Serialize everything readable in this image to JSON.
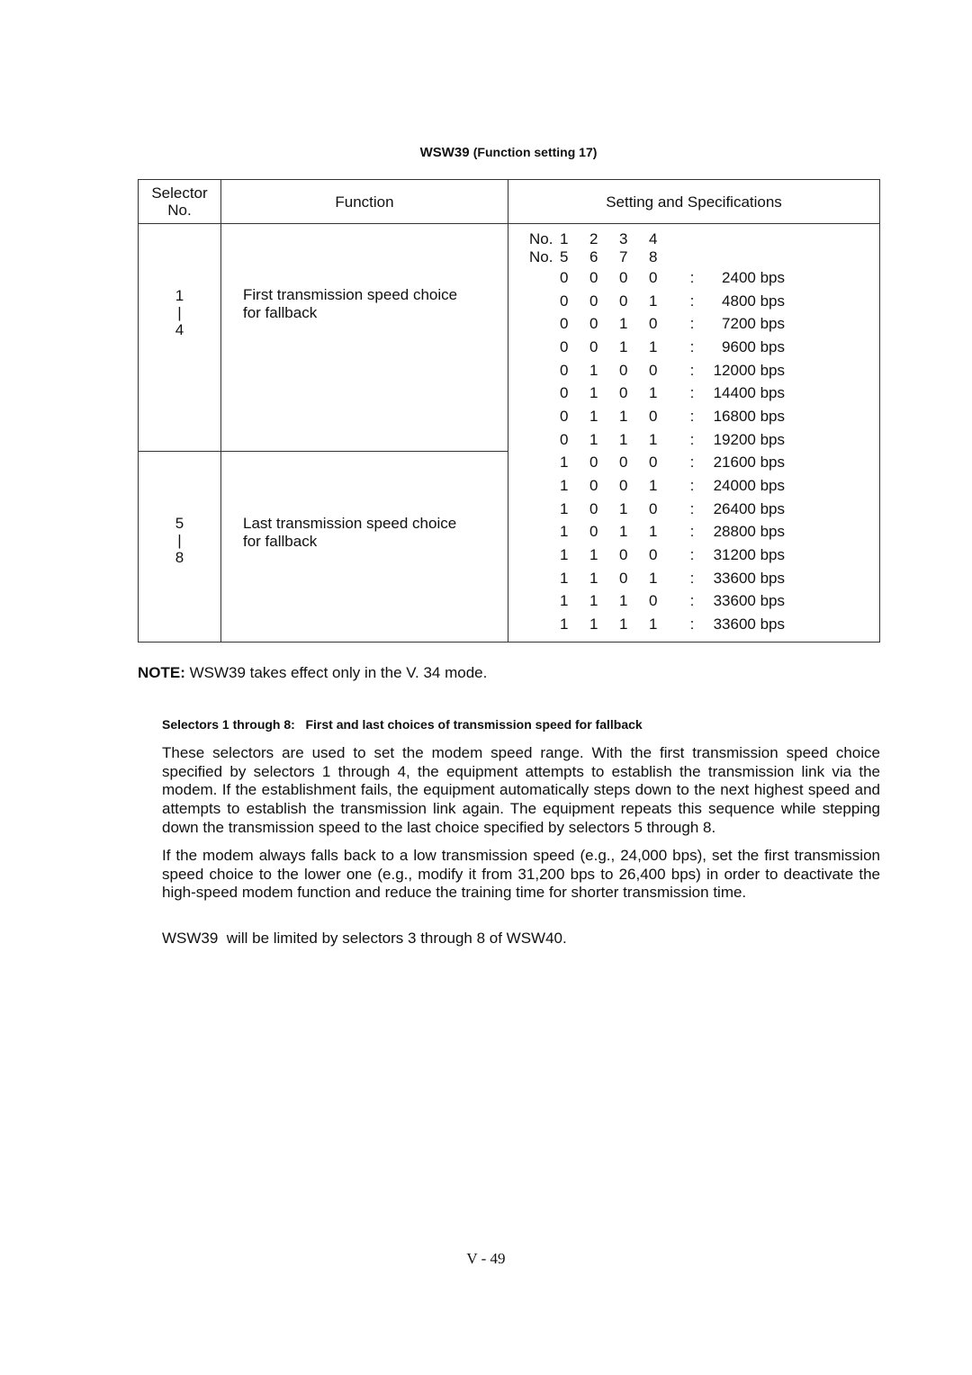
{
  "section": {
    "code": "WSW39",
    "subtitle": "(Function setting 17)"
  },
  "table": {
    "headers": {
      "selector_line1": "Selector",
      "selector_line2": "No.",
      "function": "Function",
      "settings": "Setting and Specifications"
    },
    "rows": [
      {
        "sel_start": "1",
        "sel_sep": "|",
        "sel_end": "4",
        "function_line1": "First transmission speed choice",
        "function_line2": "for fallback"
      },
      {
        "sel_start": "5",
        "sel_sep": "|",
        "sel_end": "8",
        "function_line1": "Last transmission speed choice",
        "function_line2": "for fallback"
      }
    ],
    "settings": {
      "header_rows": [
        {
          "label": "No.",
          "cols": [
            "1",
            "2",
            "3",
            "4"
          ]
        },
        {
          "label": "No.",
          "cols": [
            "5",
            "6",
            "7",
            "8"
          ]
        }
      ],
      "entries": [
        {
          "bits": [
            "0",
            "0",
            "0",
            "0"
          ],
          "sep": ":",
          "speed": "2400 bps"
        },
        {
          "bits": [
            "0",
            "0",
            "0",
            "1"
          ],
          "sep": ":",
          "speed": "4800 bps"
        },
        {
          "bits": [
            "0",
            "0",
            "1",
            "0"
          ],
          "sep": ":",
          "speed": "7200 bps"
        },
        {
          "bits": [
            "0",
            "0",
            "1",
            "1"
          ],
          "sep": ":",
          "speed": "9600 bps"
        },
        {
          "bits": [
            "0",
            "1",
            "0",
            "0"
          ],
          "sep": ":",
          "speed": "12000 bps"
        },
        {
          "bits": [
            "0",
            "1",
            "0",
            "1"
          ],
          "sep": ":",
          "speed": "14400 bps"
        },
        {
          "bits": [
            "0",
            "1",
            "1",
            "0"
          ],
          "sep": ":",
          "speed": "16800 bps"
        },
        {
          "bits": [
            "0",
            "1",
            "1",
            "1"
          ],
          "sep": ":",
          "speed": "19200 bps"
        },
        {
          "bits": [
            "1",
            "0",
            "0",
            "0"
          ],
          "sep": ":",
          "speed": "21600 bps"
        },
        {
          "bits": [
            "1",
            "0",
            "0",
            "1"
          ],
          "sep": ":",
          "speed": "24000 bps"
        },
        {
          "bits": [
            "1",
            "0",
            "1",
            "0"
          ],
          "sep": ":",
          "speed": "26400 bps"
        },
        {
          "bits": [
            "1",
            "0",
            "1",
            "1"
          ],
          "sep": ":",
          "speed": "28800 bps"
        },
        {
          "bits": [
            "1",
            "1",
            "0",
            "0"
          ],
          "sep": ":",
          "speed": "31200 bps"
        },
        {
          "bits": [
            "1",
            "1",
            "0",
            "1"
          ],
          "sep": ":",
          "speed": "33600 bps"
        },
        {
          "bits": [
            "1",
            "1",
            "1",
            "0"
          ],
          "sep": ":",
          "speed": "33600 bps"
        },
        {
          "bits": [
            "1",
            "1",
            "1",
            "1"
          ],
          "sep": ":",
          "speed": "33600 bps"
        }
      ]
    }
  },
  "note": {
    "label": "NOTE:",
    "text": "WSW39 takes effect only in the V. 34 mode."
  },
  "sub_heading": "Selectors 1 through 8:   First and last choices of transmission speed for fallback",
  "paragraphs": [
    "These selectors are used to set the modem speed range.  With the first transmission speed choice specified by selectors 1 through 4, the equipment attempts to establish the transmission link via the modem.  If the establishment fails, the equipment automatically steps down to the next highest speed and attempts to establish the transmission link again.  The equipment repeats this sequence while stepping down the transmission speed to the last choice specified by selectors 5 through 8.",
    "If the modem always falls back to a low transmission speed (e.g., 24,000 bps), set the first transmission speed choice to the lower one (e.g., modify it from 31,200 bps to 26,400 bps) in order to deactivate the high-speed modem function and reduce the training time for shorter transmission time.",
    "WSW39  will be limited by selectors 3 through 8 of WSW40."
  ],
  "page_number": "V - 49"
}
